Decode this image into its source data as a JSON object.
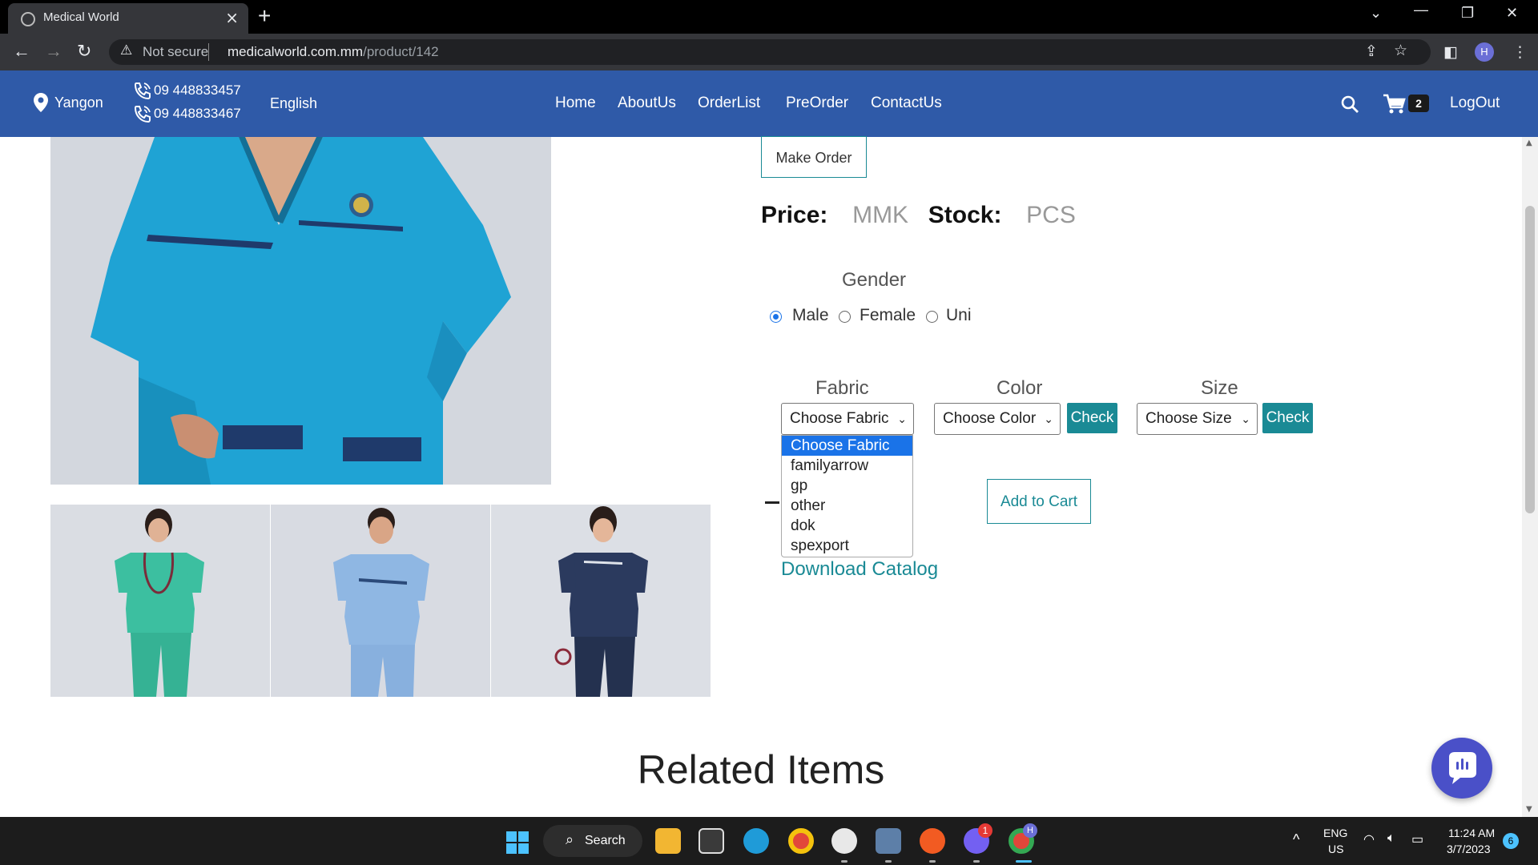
{
  "browser": {
    "tab_title": "Medical World",
    "not_secure": "Not secure",
    "url_host": "medicalworld.com.mm",
    "url_path": "/product/142",
    "profile_initial": "H"
  },
  "site_nav": {
    "location": "Yangon",
    "phones": [
      "09 448833457",
      "09 448833467"
    ],
    "language": "English",
    "links": [
      "Home",
      "AboutUs",
      "OrderList",
      "PreOrder",
      "ContactUs"
    ],
    "cart_count": "2",
    "logout": "LogOut",
    "brand_color": "#2f5aa8"
  },
  "product": {
    "make_order": "Make Order",
    "price_label": "Price:",
    "price_value": "MMK",
    "stock_label": "Stock:",
    "stock_value": "PCS",
    "gender": {
      "label": "Gender",
      "options": [
        "Male",
        "Female",
        "Uni"
      ],
      "selected": "Male"
    },
    "fabric": {
      "label": "Fabric",
      "selected": "Choose Fabric",
      "options": [
        "Choose Fabric",
        "familyarrow",
        "gp",
        "other",
        "dok",
        "spexport"
      ]
    },
    "color": {
      "label": "Color",
      "selected": "Choose Color"
    },
    "size": {
      "label": "Size",
      "selected": "Choose Size"
    },
    "check_label": "Check",
    "add_to_cart": "Add to Cart",
    "download_catalog": "Download Catalog",
    "accent_color": "#1a8a95"
  },
  "related_items_heading": "Related Items",
  "taskbar": {
    "search_label": "Search",
    "lang_top": "ENG",
    "lang_bottom": "US",
    "time": "11:24 AM",
    "date": "3/7/2023",
    "notification_count": "6",
    "viber_badge": "1",
    "chrome_badge": "H"
  }
}
